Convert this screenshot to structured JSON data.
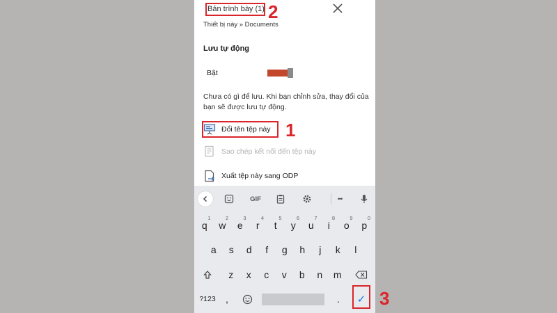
{
  "dialog": {
    "title": "Bản trình bày (1)",
    "breadcrumb": "Thiết bị này » Documents",
    "autosave_label": "Lưu tự động",
    "autosave_state": "Bật",
    "autosave_on": true,
    "note": "Chưa có gì để lưu. Khi bạn chỉnh sửa, thay đổi của bạn sẽ được lưu tự động.",
    "menu": [
      {
        "label": "Đổi tên tệp này",
        "icon": "presentation-icon",
        "enabled": true
      },
      {
        "label": "Sao chép kết nối đến tệp này",
        "icon": "copy-link-icon",
        "enabled": false
      },
      {
        "label": "Xuất tệp này sang ODP",
        "icon": "export-icon",
        "enabled": true
      }
    ]
  },
  "keyboard": {
    "toolbar": {
      "gif": "GIF",
      "more": "•••"
    },
    "row1": [
      {
        "k": "q",
        "h": "1"
      },
      {
        "k": "w",
        "h": "2"
      },
      {
        "k": "e",
        "h": "3"
      },
      {
        "k": "r",
        "h": "4"
      },
      {
        "k": "t",
        "h": "5"
      },
      {
        "k": "y",
        "h": "6"
      },
      {
        "k": "u",
        "h": "7"
      },
      {
        "k": "i",
        "h": "8"
      },
      {
        "k": "o",
        "h": "9"
      },
      {
        "k": "p",
        "h": "0"
      }
    ],
    "row2": [
      "a",
      "s",
      "d",
      "f",
      "g",
      "h",
      "j",
      "k",
      "l"
    ],
    "row3": [
      "z",
      "x",
      "c",
      "v",
      "b",
      "n",
      "m"
    ],
    "symbols_key": "?123",
    "comma_key": ",",
    "period_key": ".",
    "enter_symbol": "✓"
  },
  "callouts": {
    "one": "1",
    "two": "2",
    "three": "3"
  },
  "colors": {
    "accent_red": "#d9262b",
    "toggle_on": "#c3472b",
    "enter_blue": "#1a73e8"
  }
}
